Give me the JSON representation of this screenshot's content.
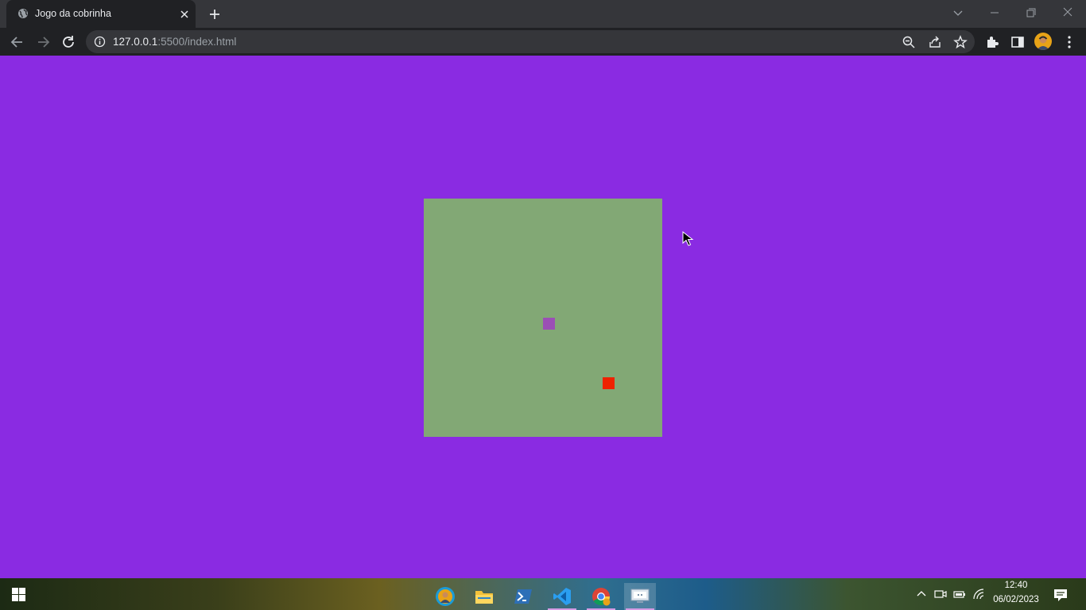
{
  "tab": {
    "title": "Jogo da cobrinha"
  },
  "omnibox": {
    "url_host": "127.0.0.1",
    "url_rest": ":5500/index.html"
  },
  "page": {
    "background_color": "#8a2be2",
    "board": {
      "background_color": "#82a875",
      "grid_cells": 20,
      "snake": {
        "color": "#9b4fb5",
        "cells": [
          [
            10,
            10
          ]
        ]
      },
      "food": {
        "color": "#ee2200",
        "cell": [
          15,
          15
        ]
      }
    }
  },
  "taskbar": {
    "apps": [
      {
        "name": "chrome-user-profile",
        "icon": "chrome-profile-icon"
      },
      {
        "name": "file-explorer",
        "icon": "folder-icon"
      },
      {
        "name": "powershell",
        "icon": "powershell-icon"
      },
      {
        "name": "vs-code",
        "icon": "vscode-icon"
      },
      {
        "name": "chrome",
        "icon": "chrome-icon"
      },
      {
        "name": "remote-desktop",
        "icon": "monitor-icon"
      }
    ],
    "clock": {
      "time": "12:40",
      "date": "06/02/2023"
    }
  }
}
